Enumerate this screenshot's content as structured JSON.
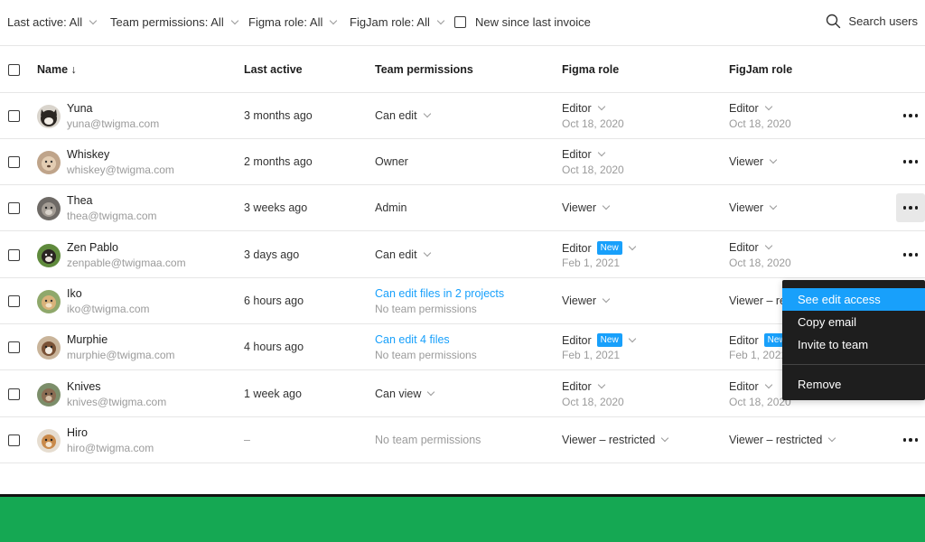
{
  "filters": {
    "last_active": "Last active: All",
    "team_permissions": "Team permissions: All",
    "figma_role": "Figma role: All",
    "figjam_role": "FigJam role: All",
    "new_since": "New since last invoice",
    "search": "Search users"
  },
  "columns": {
    "name": "Name ↓",
    "last_active": "Last active",
    "team_permissions": "Team permissions",
    "figma_role": "Figma role",
    "figjam_role": "FigJam role"
  },
  "colors": {
    "accent": "#18a0fb",
    "menu_bg": "#1e1e1e",
    "green_bar": "#15a853"
  },
  "rows": [
    {
      "name": "Yuna",
      "email": "yuna@twigma.com",
      "last_active": "3 months ago",
      "team_perm": "Can edit",
      "team_perm_sub": "",
      "figma_role": "Editor",
      "figma_badge": "",
      "figma_date": "Oct 18, 2020",
      "figjam_role": "Editor",
      "figjam_badge": "",
      "figjam_date": "Oct 18, 2020"
    },
    {
      "name": "Whiskey",
      "email": "whiskey@twigma.com",
      "last_active": "2 months ago",
      "team_perm": "Owner",
      "team_perm_sub": "",
      "figma_role": "Editor",
      "figma_badge": "",
      "figma_date": "Oct 18, 2020",
      "figjam_role": "Viewer",
      "figjam_badge": "",
      "figjam_date": ""
    },
    {
      "name": "Thea",
      "email": "thea@twigma.com",
      "last_active": "3 weeks ago",
      "team_perm": "Admin",
      "team_perm_sub": "",
      "figma_role": "Viewer",
      "figma_badge": "",
      "figma_date": "",
      "figjam_role": "Viewer",
      "figjam_badge": "",
      "figjam_date": ""
    },
    {
      "name": "Zen Pablo",
      "email": "zenpable@twigmaa.com",
      "last_active": "3 days ago",
      "team_perm": "Can edit",
      "team_perm_sub": "",
      "figma_role": "Editor",
      "figma_badge": "New",
      "figma_date": "Feb 1, 2021",
      "figjam_role": "Editor",
      "figjam_badge": "",
      "figjam_date": "Oct 18, 2020"
    },
    {
      "name": "Iko",
      "email": "iko@twigma.com",
      "last_active": "6 hours ago",
      "team_perm": "Can edit files in 2 projects",
      "team_perm_sub": "No team permissions",
      "figma_role": "Viewer",
      "figma_badge": "",
      "figma_date": "",
      "figjam_role": "Viewer – re",
      "figjam_badge": "",
      "figjam_date": ""
    },
    {
      "name": "Murphie",
      "email": "murphie@twigma.com",
      "last_active": "4 hours ago",
      "team_perm": "Can edit 4 files",
      "team_perm_sub": "No team permissions",
      "figma_role": "Editor",
      "figma_badge": "New",
      "figma_date": "Feb 1, 2021",
      "figjam_role": "Editor",
      "figjam_badge": "New",
      "figjam_date": "Feb 1, 2021"
    },
    {
      "name": "Knives",
      "email": "knives@twigma.com",
      "last_active": "1 week ago",
      "team_perm": "Can view",
      "team_perm_sub": "",
      "figma_role": "Editor",
      "figma_badge": "",
      "figma_date": "Oct 18, 2020",
      "figjam_role": "Editor",
      "figjam_badge": "",
      "figjam_date": "Oct 18, 2020"
    },
    {
      "name": "Hiro",
      "email": "hiro@twigma.com",
      "last_active": "–",
      "team_perm": "No team permissions",
      "team_perm_sub": "",
      "figma_role": "Viewer – restricted",
      "figma_badge": "",
      "figma_date": "",
      "figjam_role": "Viewer – restricted",
      "figjam_badge": "",
      "figjam_date": ""
    }
  ],
  "context_menu": {
    "see_edit_access": "See edit access",
    "copy_email": "Copy email",
    "invite_to_team": "Invite to team",
    "remove": "Remove"
  }
}
